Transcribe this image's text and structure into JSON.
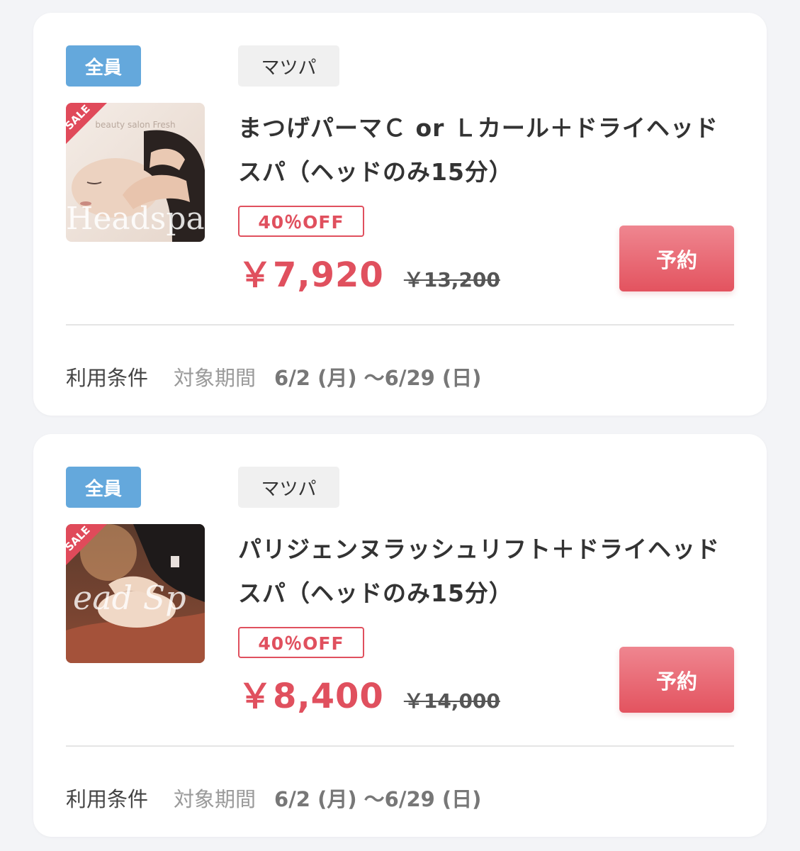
{
  "colors": {
    "accent_red": "#e0505e",
    "member_badge": "#64a8dc",
    "category_badge": "#f0f0f0"
  },
  "coupons": [
    {
      "member_badge": "全員",
      "category": "マツパ",
      "thumb_sale_label": "SALE",
      "thumb_watermark": "Headspa",
      "thumb_caption": "beauty salon Fresh",
      "title": "まつげパーマＣ or Ｌカール＋ドライヘッドスパ（ヘッドのみ15分）",
      "discount": "40％OFF",
      "price": "￥7,920",
      "old_price": "￥13,200",
      "reserve_label": "予約",
      "terms_label": "利用条件",
      "period_label": "対象期間",
      "period_dates": "6/2 (月) 〜6/29 (日)"
    },
    {
      "member_badge": "全員",
      "category": "マツパ",
      "thumb_sale_label": "SALE",
      "thumb_watermark": "ead Sp",
      "title": "パリジェンヌラッシュリフト＋ドライヘッドスパ（ヘッドのみ15分）",
      "discount": "40％OFF",
      "price": "￥8,400",
      "old_price": "￥14,000",
      "reserve_label": "予約",
      "terms_label": "利用条件",
      "period_label": "対象期間",
      "period_dates": "6/2 (月) 〜6/29 (日)"
    }
  ]
}
